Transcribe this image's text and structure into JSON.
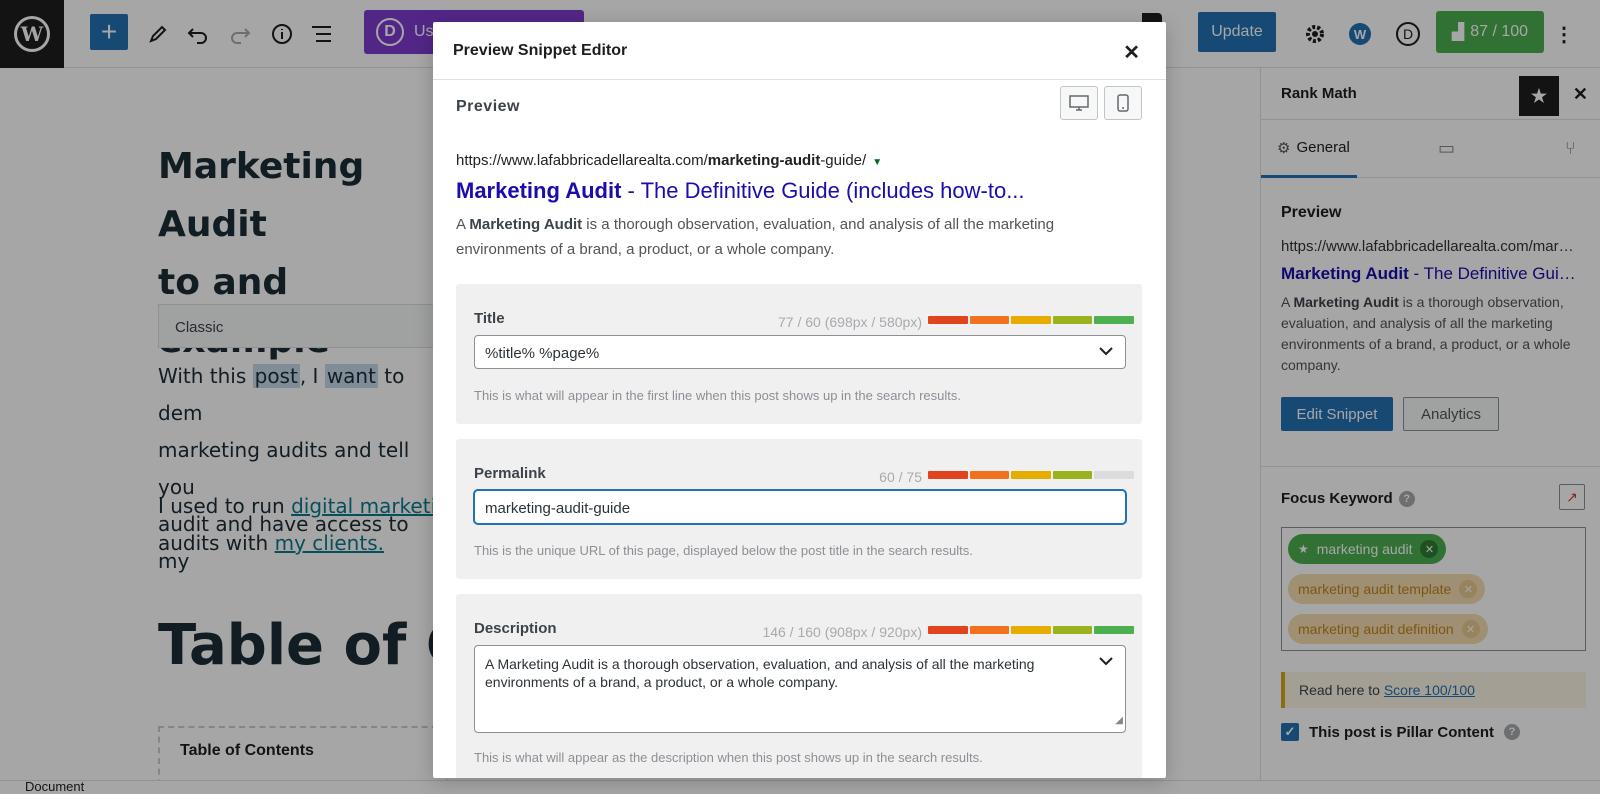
{
  "toolbar": {
    "wp_logo": "W",
    "add_label": "+",
    "divi_letter": "D",
    "divi_label": "Use Divi Builder",
    "update_label": "Update",
    "rankmath_score": "87 / 100",
    "user_initial": "D"
  },
  "editor": {
    "title": "Marketing Audit - The Definitive Guide (includes how-to and example",
    "title_line1": "Marketing Audit",
    "title_line2": "to and example",
    "classic_label": "Classic",
    "para1_pre": "With this ",
    "para1_w1": "post",
    "para1_mid": ", I ",
    "para1_w2": "want",
    "para1_post": " to dem",
    "para1_line2": "marketing audits and tell you",
    "para1_line3": "audit and have access to my",
    "para2_pre": "I used to run ",
    "para2_link": "digital marketi",
    "para2_line2_pre": "audits with ",
    "para2_link2": "my clients.",
    "toc_heading": "Table of Co",
    "toc_box_title": "Table of Contents"
  },
  "sidebar": {
    "title": "Rank Math",
    "tab_general": "General",
    "preview_title": "Preview",
    "url": "https://www.lafabbricadellarealta.com/marketing-audit-guide/",
    "serp_title_bold": "Marketing Audit",
    "serp_title_rest": " - The Definitive Guide (includes how-to...",
    "desc_pre": "A ",
    "desc_bold": "Marketing Audit",
    "desc_rest": " is a thorough observation, evaluation, and analysis of all the marketing environments of a brand, a product, or a whole company.",
    "edit_snippet": "Edit Snippet",
    "analytics": "Analytics",
    "focus_keyword": "Focus Keyword",
    "keywords": [
      "marketing audit",
      "marketing audit template",
      "marketing audit definition"
    ],
    "notice_pre": "Read here to ",
    "notice_link": "Score 100/100",
    "pillar": "This post is Pillar Content"
  },
  "footer": {
    "label": "Document"
  },
  "modal": {
    "title": "Preview Snippet Editor",
    "preview_label": "Preview",
    "url_pre": "https://www.lafabbricadellarealta.com/",
    "url_bold": "marketing-audit",
    "url_post": "-guide/",
    "serp_title_bold": "Marketing Audit",
    "serp_title_rest": " - The Definitive Guide (includes how-to...",
    "desc_pre": "A ",
    "desc_bold": "Marketing Audit",
    "desc_rest": " is a thorough observation, evaluation, and analysis of all the marketing environments of a brand, a product, or a whole company.",
    "title_field": {
      "label": "Title",
      "count": "77 / 60 (698px / 580px)",
      "value": "%title% %page%",
      "help": "This is what will appear in the first line when this post shows up in the search results."
    },
    "permalink_field": {
      "label": "Permalink",
      "count": "60 / 75",
      "value": "marketing-audit-guide",
      "help": "This is the unique URL of this page, displayed below the post title in the search results."
    },
    "description_field": {
      "label": "Description",
      "count": "146 / 160 (908px / 920px)",
      "value": "A Marketing Audit is a thorough observation, evaluation, and analysis of all the marketing environments of a brand, a product, or a whole company.",
      "help": "This is what will appear as the description when this post shows up in the search results."
    }
  },
  "colors": {
    "meter": [
      "#e0441f",
      "#f2711c",
      "#e6ac00",
      "#9bb21e",
      "#4caf50"
    ],
    "meter_empty": "#dcdcde"
  }
}
